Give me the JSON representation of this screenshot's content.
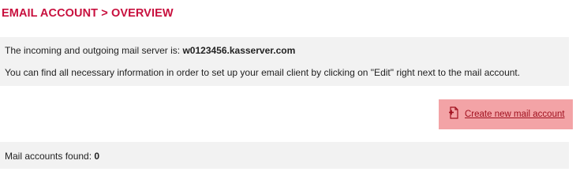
{
  "header": {
    "title": "EMAIL ACCOUNT > OVERVIEW"
  },
  "info": {
    "server_label": "The incoming and outgoing mail server is:",
    "server_value": "w0123456.kasserver.com",
    "help_text": "You can find all necessary information in order to set up your email client by clicking on \"Edit\" right next to the mail account."
  },
  "actions": {
    "create_label": "Create new mail account",
    "create_icon": "new-document-plus-icon"
  },
  "summary": {
    "found_label": "Mail accounts found:",
    "found_count": "0"
  },
  "colors": {
    "accent": "#c8103e",
    "button_bg": "#f3a3a6",
    "panel_bg": "#f2f2f2"
  }
}
